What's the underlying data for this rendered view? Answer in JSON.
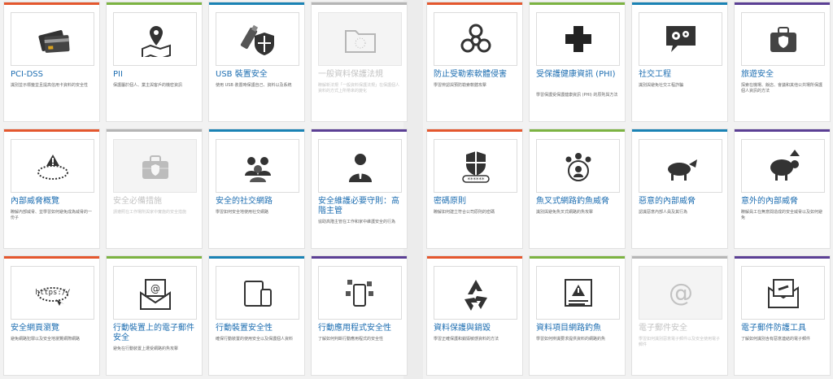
{
  "colors": {
    "red": "#e4572e",
    "green": "#7cb342",
    "blue": "#1a82b4",
    "gray": "#b5b5b5",
    "purple": "#5b3f94",
    "title_blue": "#1f6fb2"
  },
  "left_courses": [
    {
      "title": "PCI-DSS",
      "desc": "識別並示標籤並且提高信用卡資料的安全性",
      "accent": "red",
      "icon": "credit-card-icon",
      "disabled": false
    },
    {
      "title": "PII",
      "desc": "保護屬於個人、業主與客戶的機密資訊",
      "accent": "green",
      "icon": "map-pin-icon",
      "disabled": false
    },
    {
      "title": "USB 裝置安全",
      "desc": "使用 USB 裝置時保護自己、資料以及系統",
      "accent": "blue",
      "icon": "usb-shield-icon",
      "disabled": false
    },
    {
      "title": "一般資料保護法規",
      "desc": "瞭解新法規「一般資料保護法規」在保護個人資料的方式上所帶來的變化",
      "accent": "gray",
      "icon": "folder-eu-icon",
      "disabled": true
    },
    {
      "title": "內部威脅概覽",
      "desc": "瞭解內部威脅、並學習如何避免成為威脅的一份子",
      "accent": "red",
      "icon": "insider-threat-icon",
      "disabled": false
    },
    {
      "title": "安全必備措施",
      "desc": "請遵照在工作場所與家中實施的安全措施",
      "accent": "gray",
      "icon": "toolbox-icon",
      "disabled": true
    },
    {
      "title": "安全的社交網路",
      "desc": "學習如何安全地使用社交網路",
      "accent": "blue",
      "icon": "social-network-icon",
      "disabled": false
    },
    {
      "title": "安全維護必要守則：高階主管",
      "desc": "協助高階主管在工作和家中維護安全的行為",
      "accent": "purple",
      "icon": "executive-icon",
      "disabled": false
    },
    {
      "title": "安全網頁瀏覽",
      "desc": "避免網路犯罪以及安全地瀏覽網際網路",
      "accent": "red",
      "icon": "browser-https-icon",
      "disabled": false
    },
    {
      "title": "行動裝置上的電子郵件安全",
      "desc": "避免在行動裝置上遭受網路釣魚攻擊",
      "accent": "green",
      "icon": "mobile-email-icon",
      "disabled": false
    },
    {
      "title": "行動裝置安全性",
      "desc": "確保行動裝置的使用安全以及保護個人資料",
      "accent": "blue",
      "icon": "tablet-phone-icon",
      "disabled": false
    },
    {
      "title": "行動應用程式安全性",
      "desc": "了解如何判斷行動應用程式的安全性",
      "accent": "purple",
      "icon": "mobile-apps-icon",
      "disabled": false
    }
  ],
  "right_courses": [
    {
      "title": "防止受勒索軟體侵害",
      "desc": "學習辨認與預防勒索軟體攻擊",
      "accent": "red",
      "icon": "biohazard-icon",
      "disabled": false
    },
    {
      "title": "受保護健康資訊 (PHI)",
      "desc": "學習保護受保護健康資訊 (PHI) 的原則與方法",
      "accent": "green",
      "icon": "medical-cross-icon",
      "disabled": false
    },
    {
      "title": "社交工程",
      "desc": "識別與避免社交工程詐騙",
      "accent": "blue",
      "icon": "gears-chat-icon",
      "disabled": false
    },
    {
      "title": "旅遊安全",
      "desc": "探索在機場、飯店、會議和其他公共場所保護個人資訊的方法",
      "accent": "purple",
      "icon": "suitcase-icon",
      "disabled": false
    },
    {
      "title": "密碼原則",
      "desc": "瞭解如何建立符合公司原則的密碼",
      "accent": "red",
      "icon": "password-shield-icon",
      "disabled": false
    },
    {
      "title": "魚叉式網路釣魚威脅",
      "desc": "識別與避免魚叉式網路釣魚攻擊",
      "accent": "green",
      "icon": "spear-phishing-icon",
      "disabled": false
    },
    {
      "title": "惡意的內部威脅",
      "desc": "認識惡意內部人員及其行為",
      "accent": "blue",
      "icon": "wolf-sheep-icon",
      "disabled": false
    },
    {
      "title": "意外的內部威脅",
      "desc": "瞭解員工在無意間造成的安全威脅以及如何避免",
      "accent": "purple",
      "icon": "sheep-icon",
      "disabled": false
    },
    {
      "title": "資料保護與銷毀",
      "desc": "學習正確保護和銷毀敏感資料的方法",
      "accent": "red",
      "icon": "recycle-icon",
      "disabled": false
    },
    {
      "title": "資料項目網路釣魚",
      "desc": "學習如何辨識要求提供資料的網路釣魚",
      "accent": "green",
      "icon": "phishing-form-icon",
      "disabled": false
    },
    {
      "title": "電子郵件安全",
      "desc": "學習如何識別惡意電子郵件以及安全使用電子郵件",
      "accent": "gray",
      "icon": "at-sign-icon",
      "disabled": true
    },
    {
      "title": "電子郵件防護工具",
      "desc": "了解如何識別含有惡意連結的電子郵件",
      "accent": "purple",
      "icon": "email-link-icon",
      "disabled": false
    }
  ]
}
